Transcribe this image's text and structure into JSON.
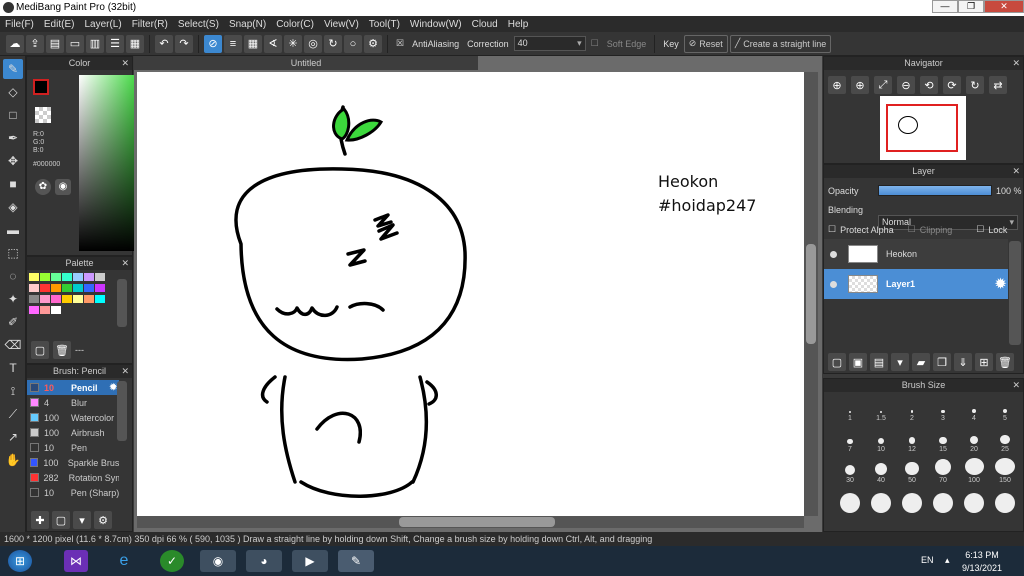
{
  "window": {
    "title": "MediBang Paint Pro (32bit)",
    "min": "—",
    "max": "❐",
    "close": "✕"
  },
  "menu": [
    "File(F)",
    "Edit(E)",
    "Layer(L)",
    "Filter(R)",
    "Select(S)",
    "Snap(N)",
    "Color(C)",
    "View(V)",
    "Tool(T)",
    "Window(W)",
    "Cloud",
    "Help"
  ],
  "toolbar": {
    "antialias": "AntiAliasing",
    "correction_label": "Correction",
    "correction_value": "40",
    "soft_edge": "Soft Edge",
    "key": "Key",
    "reset": "Reset",
    "straight_line": "Create a straight line"
  },
  "canvas": {
    "tab": "Untitled",
    "text1": "Heokon",
    "text2": "#hoidap247"
  },
  "color_panel": {
    "title": "Color",
    "r": "R:0",
    "g": "G:0",
    "b": "B:0",
    "hex": "#000000"
  },
  "palette_panel": {
    "title": "Palette",
    "dash": "---",
    "swatches": [
      "#ffff66",
      "#99ff33",
      "#66ff99",
      "#33ffcc",
      "#99ccff",
      "#cc99ff",
      "#cccccc",
      "#ffcccc",
      "#ff3333",
      "#ff9900",
      "#33cc33",
      "#00cccc",
      "#3366ff",
      "#cc33ff",
      "#888888",
      "#ff99cc",
      "#ff66cc",
      "#ffcc00",
      "#ffff99",
      "#ff9966",
      "#00ffff",
      "#ff66ff",
      "#ff9999",
      "#ffffff"
    ]
  },
  "brush_panel": {
    "title": "Brush: Pencil",
    "items": [
      {
        "size": "10",
        "name": "Pencil",
        "color": "#2b4a7a"
      },
      {
        "size": "4",
        "name": "Blur",
        "color": "#ff88ff"
      },
      {
        "size": "100",
        "name": "Watercolor",
        "color": "#66ccff"
      },
      {
        "size": "100",
        "name": "Airbrush",
        "color": "#cccccc"
      },
      {
        "size": "10",
        "name": "Pen",
        "color": "#333333"
      },
      {
        "size": "100",
        "name": "Sparkle Brush",
        "color": "#3355ff"
      },
      {
        "size": "282",
        "name": "Rotation Sym",
        "color": "#ff3333"
      },
      {
        "size": "10",
        "name": "Pen (Sharp)",
        "color": "#333333"
      }
    ]
  },
  "navigator": {
    "title": "Navigator"
  },
  "layer_panel": {
    "title": "Layer",
    "opacity_label": "Opacity",
    "opacity_value": "100 %",
    "opacity_level": 1.0,
    "blending_label": "Blending",
    "blending_value": "Normal",
    "protect_alpha": "Protect Alpha",
    "clipping": "Clipping",
    "lock": "Lock",
    "layers": [
      {
        "name": "Heokon"
      },
      {
        "name": "Layer1"
      }
    ]
  },
  "brush_size_panel": {
    "title": "Brush Size",
    "sizes": [
      "1",
      "1.5",
      "2",
      "3",
      "4",
      "5",
      "7",
      "10",
      "12",
      "15",
      "20",
      "25",
      "30",
      "40",
      "50",
      "70",
      "100",
      "150",
      "",
      "",
      "",
      "",
      "",
      ""
    ]
  },
  "status": {
    "text": "1600 * 1200 pixel   (11.6 * 8.7cm)   350 dpi   66 %   ( 590, 1035 )   Draw a straight line by holding down Shift, Change a brush size by holding down Ctrl, Alt, and dragging"
  },
  "taskbar": {
    "lang": "EN",
    "time": "6:13 PM",
    "date": "9/13/2021"
  }
}
